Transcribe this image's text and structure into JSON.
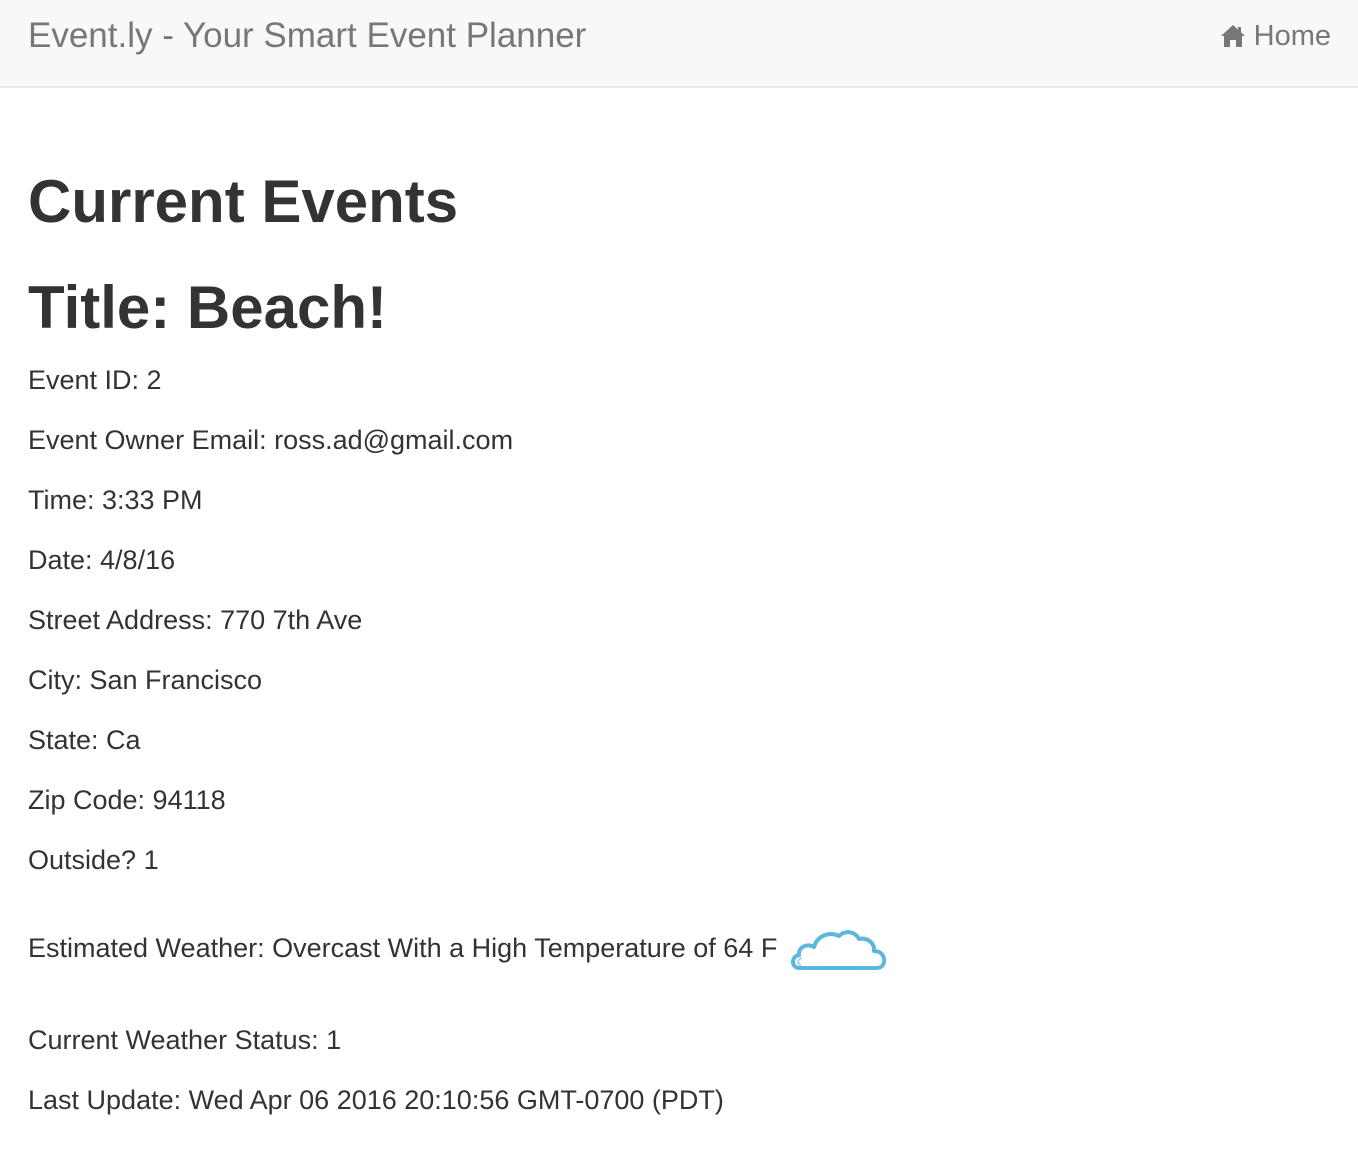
{
  "navbar": {
    "brand": "Event.ly - Your Smart Event Planner",
    "home_label": "Home",
    "home_icon": "home-icon"
  },
  "page": {
    "heading": "Current Events"
  },
  "event": {
    "title": "Title: Beach!",
    "event_id": "Event ID: 2",
    "owner_email": "Event Owner Email: ross.ad@gmail.com",
    "time": "Time: 3:33 PM",
    "date": "Date: 4/8/16",
    "street": "Street Address: 770 7th Ave",
    "city": "City: San Francisco",
    "state": "State: Ca",
    "zip": "Zip Code: 94118",
    "outside": "Outside? 1",
    "weather": "Estimated Weather: Overcast With a High Temperature of 64 F",
    "weather_icon": "cloud-icon",
    "weather_status": "Current Weather Status: 1",
    "last_update": "Last Update: Wed Apr 06 2016 20:10:56 GMT-0700 (PDT)"
  },
  "colors": {
    "navbar_bg": "#f8f8f8",
    "navbar_text": "#777777",
    "body_text": "#333333",
    "cloud_stroke": "#5bb8dc"
  }
}
